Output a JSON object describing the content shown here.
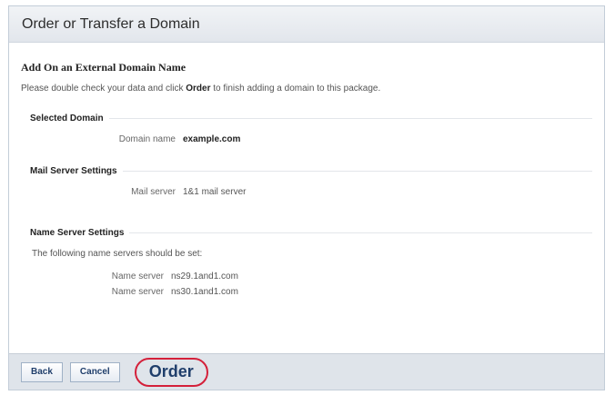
{
  "page": {
    "title": "Order or Transfer a Domain",
    "subtitle": "Add On an External Domain Name",
    "intro_before": "Please double check your data and click ",
    "intro_strong": "Order",
    "intro_after": " to finish adding a domain to this package."
  },
  "sections": {
    "selected_domain": {
      "heading": "Selected Domain",
      "label": "Domain name",
      "value": "example.com"
    },
    "mail_server": {
      "heading": "Mail Server Settings",
      "label": "Mail server",
      "value": "1&1 mail server"
    },
    "name_server": {
      "heading": "Name Server Settings",
      "note": "The following name servers should be set:",
      "rows": [
        {
          "label": "Name server",
          "value": "ns29.1and1.com"
        },
        {
          "label": "Name server",
          "value": "ns30.1and1.com"
        }
      ]
    }
  },
  "footer": {
    "back_label": "Back",
    "cancel_label": "Cancel",
    "order_label": "Order"
  },
  "colors": {
    "accent_red": "#d4203a",
    "button_text": "#1f3e6b"
  }
}
